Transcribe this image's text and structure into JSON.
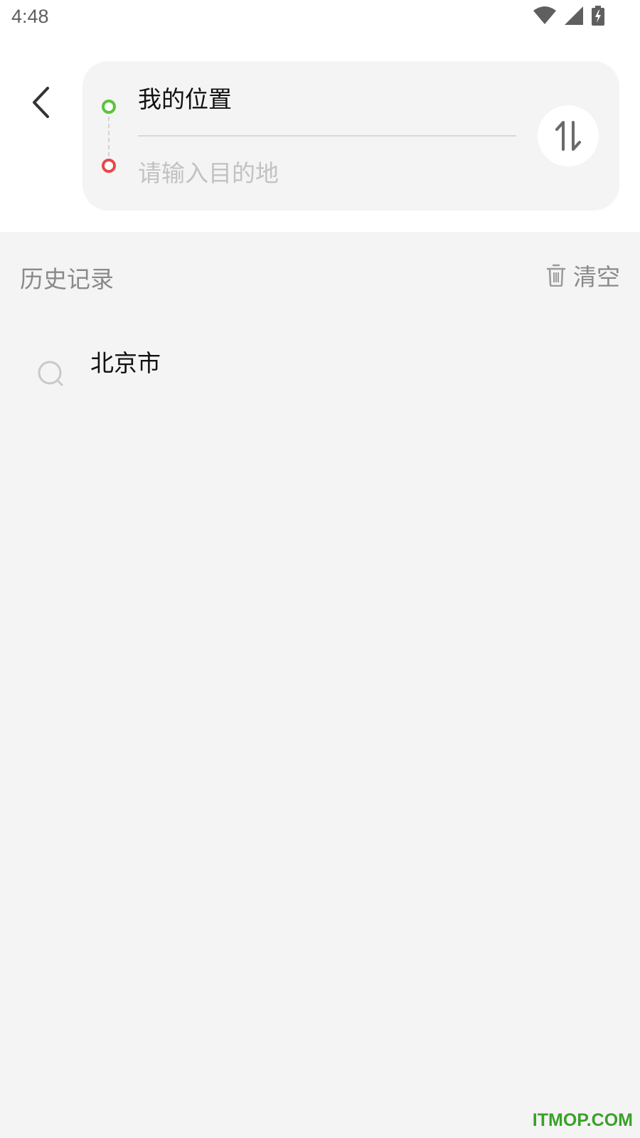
{
  "status_bar": {
    "time": "4:48",
    "icons": [
      "wifi-icon",
      "cell-signal-icon",
      "battery-charging-icon"
    ]
  },
  "route": {
    "origin_value": "我的位置",
    "destination_placeholder": "请输入目的地",
    "start_dot_color": "#5ac43b",
    "end_dot_color": "#e84848"
  },
  "history": {
    "title": "历史记录",
    "clear_label": "清空",
    "items": [
      {
        "label": "北京市",
        "icon": "search-icon"
      }
    ]
  },
  "watermark": "ITMOP.COM",
  "colors": {
    "background": "#f4f4f4",
    "card": "#f4f4f4",
    "secondary_text": "#8a8a8a",
    "watermark": "#3aa12a"
  }
}
